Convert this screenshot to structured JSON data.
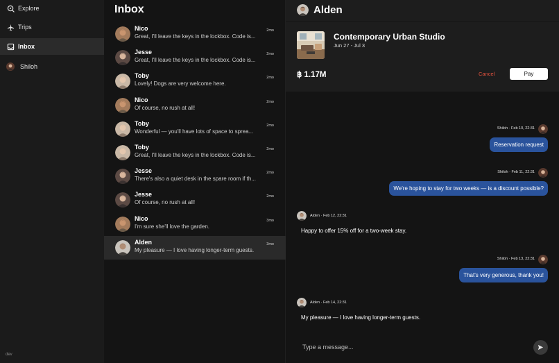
{
  "sidebar": {
    "items": [
      {
        "label": "Explore",
        "icon": "compass-icon"
      },
      {
        "label": "Trips",
        "icon": "airplane-icon"
      },
      {
        "label": "Inbox",
        "icon": "inbox-icon"
      }
    ],
    "user": {
      "label": "Shiloh"
    },
    "footer": "dev"
  },
  "inbox": {
    "title": "Inbox",
    "conversations": [
      {
        "name": "Nico",
        "snippet": "Great, I'll leave the keys in the lockbox. Code is...",
        "time": "2mo"
      },
      {
        "name": "Jesse",
        "snippet": "Great, I'll leave the keys in the lockbox. Code is...",
        "time": "2mo"
      },
      {
        "name": "Toby",
        "snippet": "Lovely! Dogs are very welcome here.",
        "time": "2mo"
      },
      {
        "name": "Nico",
        "snippet": "Of course, no rush at all!",
        "time": "2mo"
      },
      {
        "name": "Toby",
        "snippet": "Wonderful — you'll have lots of space to sprea...",
        "time": "2mo"
      },
      {
        "name": "Toby",
        "snippet": "Great, I'll leave the keys in the lockbox. Code is...",
        "time": "2mo"
      },
      {
        "name": "Jesse",
        "snippet": "There's also a quiet desk in the spare room if th...",
        "time": "2mo"
      },
      {
        "name": "Jesse",
        "snippet": "Of course, no rush at all!",
        "time": "2mo"
      },
      {
        "name": "Nico",
        "snippet": "I'm sure she'll love the garden.",
        "time": "3mo"
      },
      {
        "name": "Alden",
        "snippet": "My pleasure — I love having longer-term guests.",
        "time": "3mo"
      }
    ]
  },
  "chat": {
    "title": "Alden",
    "listing": {
      "title": "Contemporary Urban Studio",
      "dates": "Jun 27 - Jul 3",
      "price": "฿ 1.17M",
      "cancel_label": "Cancel",
      "pay_label": "Pay"
    },
    "messages": [
      {
        "meta": "Shiloh · Feb 10, 22:31",
        "text": "Reservation request"
      },
      {
        "meta": "Shiloh · Feb 11, 22:31",
        "text": "We're hoping to stay for two weeks — is a discount possible?"
      },
      {
        "meta": "Alden · Feb 12, 22:31",
        "text": "Happy to offer 15% off for a two-week stay."
      },
      {
        "meta": "Shiloh · Feb 13, 22:31",
        "text": "That's very generous, thank you!"
      },
      {
        "meta": "Alden · Feb 14, 22:31",
        "text": "My pleasure — I love having longer-term guests."
      }
    ],
    "composer_placeholder": "Type a message..."
  },
  "colors": {
    "accent": "#2a539c",
    "cancel": "#e0523e",
    "background": "#141414",
    "panel": "#1d1d1d"
  }
}
